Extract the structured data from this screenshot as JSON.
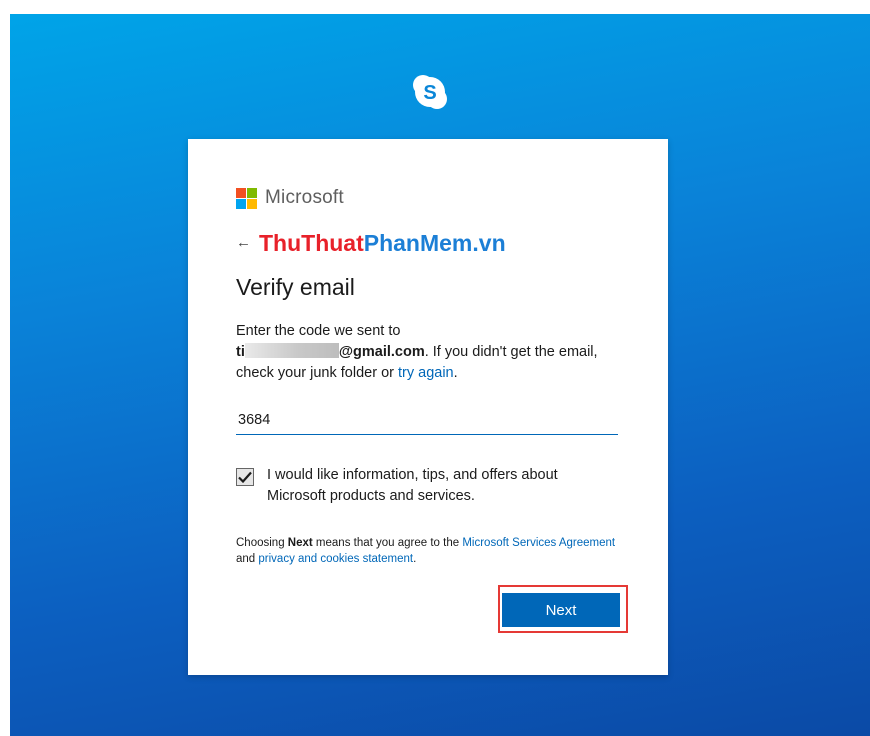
{
  "brand": {
    "app_logo_icon": "skype-icon",
    "app_logo_glyph": "S",
    "company_name": "Microsoft",
    "logo_colors": [
      "#f25022",
      "#7fba00",
      "#00a4ef",
      "#ffb900"
    ]
  },
  "watermark": {
    "part_red": "ThuThuat",
    "part_blue": "PhanMem.vn"
  },
  "back": {
    "icon": "back-arrow-icon",
    "glyph": "←"
  },
  "page": {
    "title": "Verify email"
  },
  "description": {
    "line_intro": "Enter the code we sent to",
    "email_prefix": "ti",
    "email_suffix": "@gmail.com",
    "after_email": ". If you didn't get the email, check your junk folder or ",
    "retry_link": "try again",
    "end": "."
  },
  "code_field": {
    "value": "3684"
  },
  "marketing_opt_in": {
    "checked": true,
    "label": "I would like information, tips, and offers about Microsoft products and services."
  },
  "terms": {
    "prefix": "Choosing ",
    "bold_word": "Next",
    "middle": " means that you agree to the ",
    "agreement_link": "Microsoft Services Agreement",
    "and_text": " and ",
    "privacy_link": "privacy and cookies statement",
    "end": "."
  },
  "actions": {
    "next_label": "Next"
  },
  "colors": {
    "accent": "#0067b8",
    "highlight": "#e53935"
  }
}
